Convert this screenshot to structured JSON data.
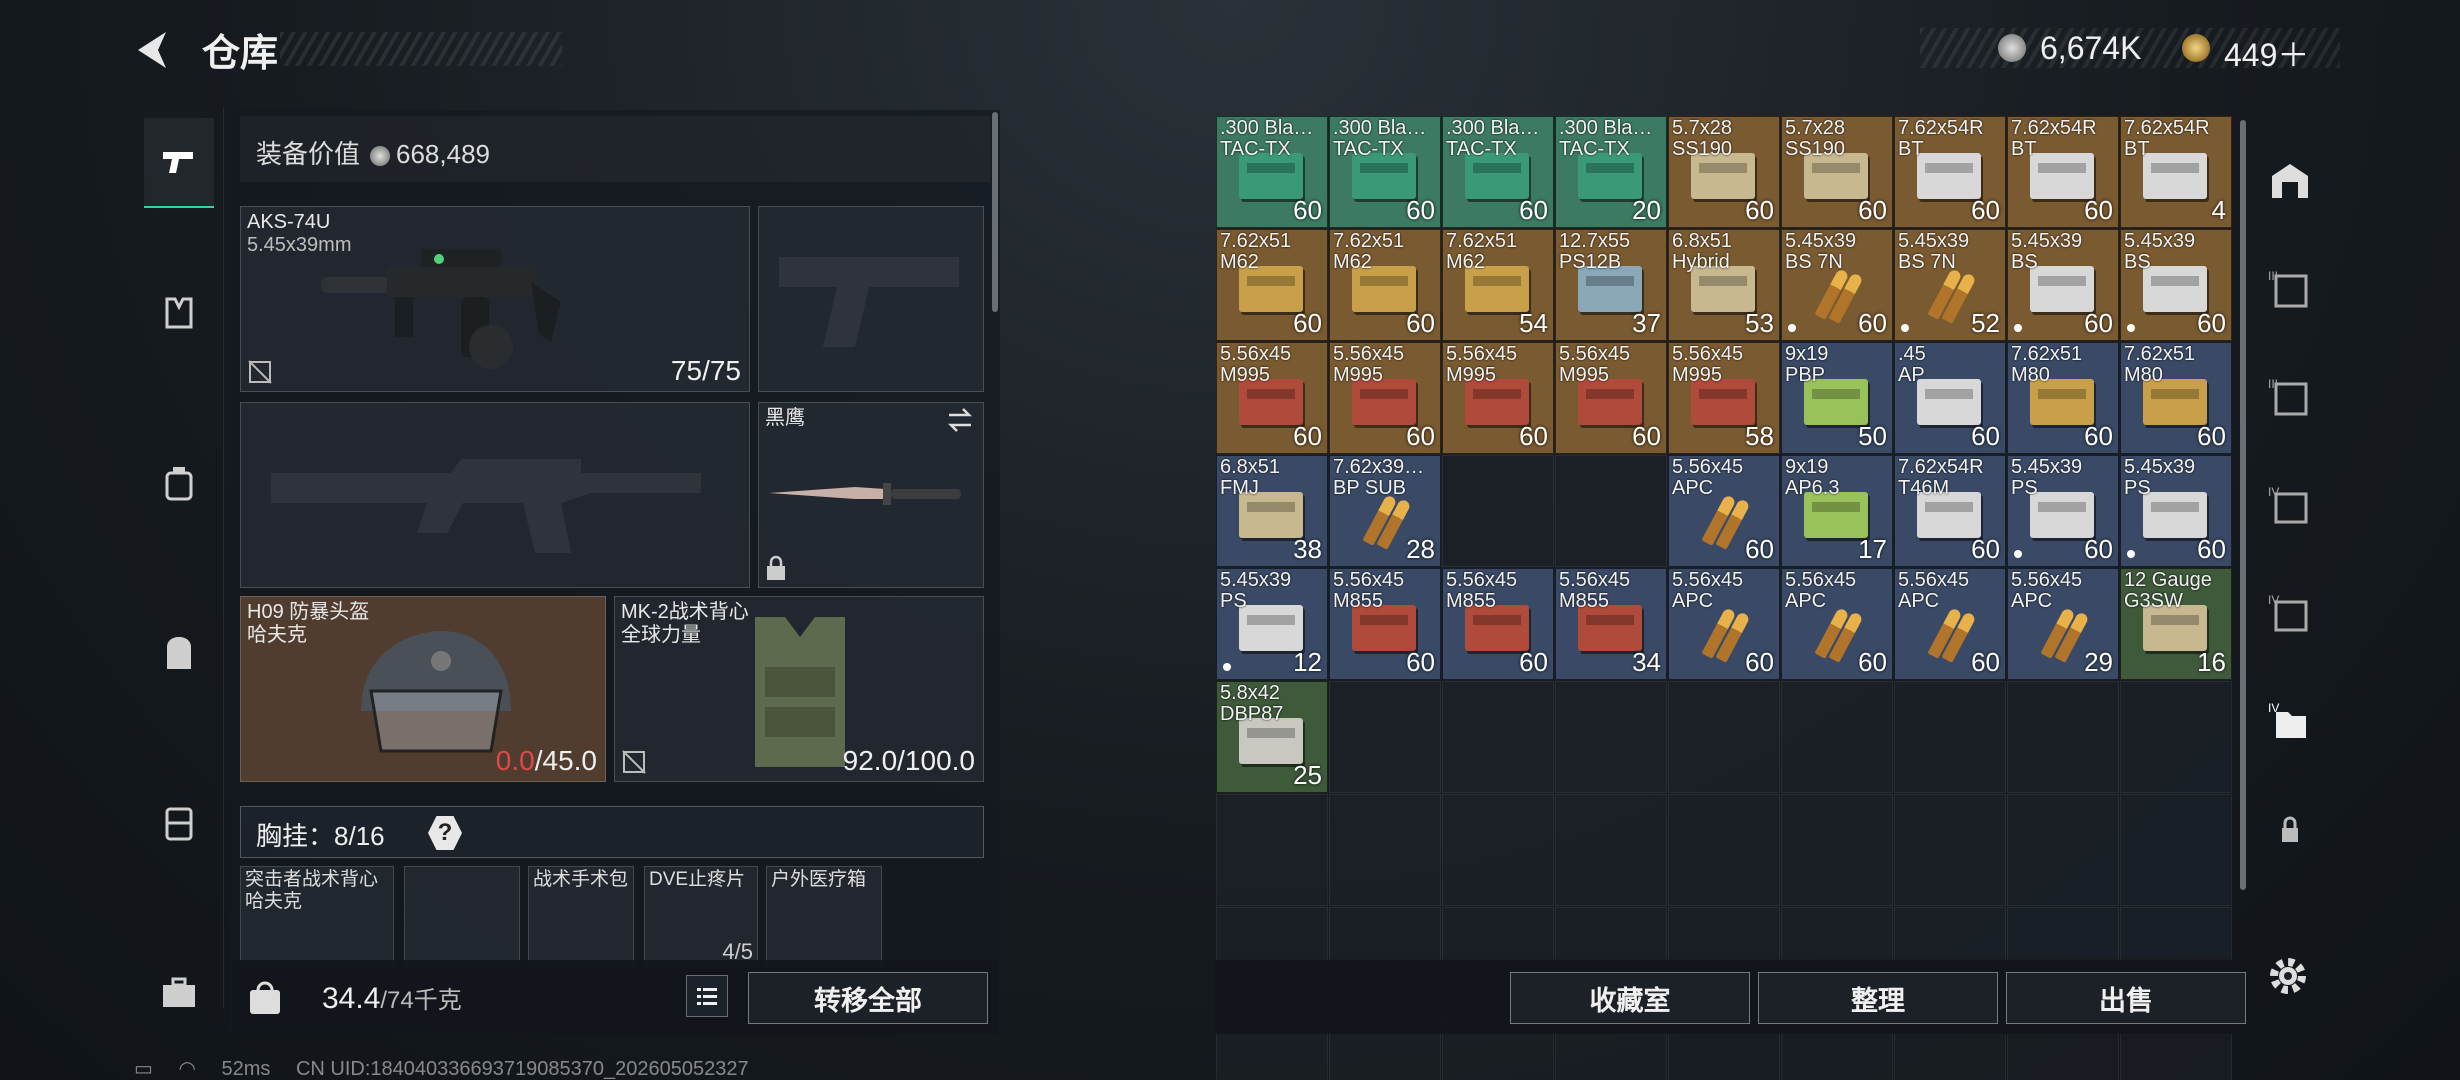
{
  "header": {
    "title": "仓库",
    "money": "6,674K",
    "gold": "449＋"
  },
  "left_nav": {
    "items": [
      "pistol-icon",
      "vest-icon",
      "backpack-armor-icon",
      "backpack-icon",
      "case-icon",
      "toolbox-icon"
    ]
  },
  "equipment": {
    "value_label": "装备价值",
    "value": "668,489",
    "primary": {
      "name": "AKS-74U",
      "caliber": "5.45x39mm",
      "ammo": "75/75"
    },
    "melee": {
      "name": "黑鹰"
    },
    "helmet": {
      "name": "H09 防暴头盔",
      "brand": "哈夫克",
      "durability_current": "0.0",
      "durability_max": "/45.0"
    },
    "armor": {
      "name": "MK-2战术背心",
      "brand": "全球力量",
      "durability": "92.0/100.0"
    },
    "rig": {
      "label": "胸挂：",
      "count": "8/16",
      "help": "?",
      "slots": [
        {
          "name": "突击者战术背心\n哈夫克"
        },
        {
          "name": ""
        },
        {
          "name": "战术手术包"
        },
        {
          "name": "DVE止疼片",
          "count": "4/5"
        },
        {
          "name": "户外医疗箱"
        }
      ]
    },
    "weight": "34.4",
    "weight_max": "/74千克",
    "transfer_all": "转移全部"
  },
  "stash": {
    "items": [
      {
        "name": ".300 Bla…\nTAC-TX",
        "count": "60",
        "color": "#3d7a62",
        "box": "#3a9a78"
      },
      {
        "name": ".300 Bla…\nTAC-TX",
        "count": "60",
        "color": "#3d7a62",
        "box": "#3a9a78"
      },
      {
        "name": ".300 Bla…\nTAC-TX",
        "count": "60",
        "color": "#3d7a62",
        "box": "#3a9a78"
      },
      {
        "name": ".300 Bla…\nTAC-TX",
        "count": "20",
        "color": "#3d7a62",
        "box": "#3a9a78"
      },
      {
        "name": "5.7x28\nSS190",
        "count": "60",
        "color": "#7a5a30",
        "box": "#c8b890"
      },
      {
        "name": "5.7x28\nSS190",
        "count": "60",
        "color": "#7a5a30",
        "box": "#c8b890"
      },
      {
        "name": "7.62x54R\nBT",
        "count": "60",
        "color": "#7a5a30",
        "box": "#d8d8d8"
      },
      {
        "name": "7.62x54R\nBT",
        "count": "60",
        "color": "#7a5a30",
        "box": "#d8d8d8"
      },
      {
        "name": "7.62x54R\nBT",
        "count": "4",
        "color": "#7a5a30",
        "box": "#d8d8d8"
      },
      {
        "name": "7.62x51\nM62",
        "count": "60",
        "color": "#7a5a30",
        "box": "#c9a04a"
      },
      {
        "name": "7.62x51\nM62",
        "count": "60",
        "color": "#7a5a30",
        "box": "#c9a04a"
      },
      {
        "name": "7.62x51\nM62",
        "count": "54",
        "color": "#7a5a30",
        "box": "#c9a04a"
      },
      {
        "name": "12.7x55\nPS12B",
        "count": "37",
        "color": "#7a5a30",
        "box": "#8aa8b8"
      },
      {
        "name": "6.8x51\nHybrid",
        "count": "53",
        "color": "#7a5a30",
        "box": "#c8b890"
      },
      {
        "name": "5.45x39\nBS 7N",
        "count": "60",
        "dot": true,
        "color": "#7a5a30",
        "cart": true
      },
      {
        "name": "5.45x39\nBS 7N",
        "count": "52",
        "dot": true,
        "color": "#7a5a30",
        "cart": true
      },
      {
        "name": "5.45x39\nBS",
        "count": "60",
        "dot": true,
        "color": "#7a5a30",
        "box": "#d8d8d8"
      },
      {
        "name": "5.45x39\nBS",
        "count": "60",
        "dot": true,
        "color": "#7a5a30",
        "box": "#d8d8d8"
      },
      {
        "name": "5.56x45\nM995",
        "count": "60",
        "color": "#7a5a30",
        "box": "#b04a3a"
      },
      {
        "name": "5.56x45\nM995",
        "count": "60",
        "color": "#7a5a30",
        "box": "#b04a3a"
      },
      {
        "name": "5.56x45\nM995",
        "count": "60",
        "color": "#7a5a30",
        "box": "#b04a3a"
      },
      {
        "name": "5.56x45\nM995",
        "count": "60",
        "color": "#7a5a30",
        "box": "#b04a3a"
      },
      {
        "name": "5.56x45\nM995",
        "count": "58",
        "color": "#7a5a30",
        "box": "#b04a3a"
      },
      {
        "name": "9x19\nPBP",
        "count": "50",
        "color": "#3a4a66",
        "box": "#9ac25a"
      },
      {
        "name": ".45\nAP",
        "count": "60",
        "color": "#3a4a66",
        "box": "#d8d8d8"
      },
      {
        "name": "7.62x51\nM80",
        "count": "60",
        "color": "#3a4a66",
        "box": "#c9a04a"
      },
      {
        "name": "7.62x51\nM80",
        "count": "60",
        "color": "#3a4a66",
        "box": "#c9a04a"
      },
      {
        "name": "6.8x51\nFMJ",
        "count": "38",
        "color": "#3a4a66",
        "box": "#c8b890"
      },
      {
        "name": "7.62x39…\nBP SUB",
        "count": "28",
        "color": "#3a4a66",
        "cart": true
      },
      null,
      null,
      {
        "name": "5.56x45\nAPC",
        "count": "60",
        "color": "#3a4a66",
        "cart": true
      },
      {
        "name": "9x19\nAP6.3",
        "count": "17",
        "color": "#3a4a66",
        "box": "#9ac25a"
      },
      {
        "name": "7.62x54R\nT46M",
        "count": "60",
        "color": "#3a4a66",
        "box": "#d8d8d8"
      },
      {
        "name": "5.45x39\nPS",
        "count": "60",
        "dot": true,
        "color": "#3a4a66",
        "box": "#d8d8d8"
      },
      {
        "name": "5.45x39\nPS",
        "count": "60",
        "dot": true,
        "color": "#3a4a66",
        "box": "#d8d8d8"
      },
      {
        "name": "5.45x39\nPS",
        "count": "12",
        "dot": true,
        "color": "#3a4a66",
        "box": "#d8d8d8"
      },
      {
        "name": "5.56x45\nM855",
        "count": "60",
        "color": "#3a4a66",
        "box": "#b04a3a"
      },
      {
        "name": "5.56x45\nM855",
        "count": "60",
        "color": "#3a4a66",
        "box": "#b04a3a"
      },
      {
        "name": "5.56x45\nM855",
        "count": "34",
        "color": "#3a4a66",
        "box": "#b04a3a"
      },
      {
        "name": "5.56x45\nAPC",
        "count": "60",
        "color": "#3a4a66",
        "cart": true
      },
      {
        "name": "5.56x45\nAPC",
        "count": "60",
        "color": "#3a4a66",
        "cart": true
      },
      {
        "name": "5.56x45\nAPC",
        "count": "60",
        "color": "#3a4a66",
        "cart": true
      },
      {
        "name": "5.56x45\nAPC",
        "count": "29",
        "color": "#3a4a66",
        "cart": true
      },
      {
        "name": "12 Gauge\nG3SW",
        "count": "16",
        "color": "#3e5a3a",
        "box": "#c8b890"
      },
      {
        "name": "5.8x42\nDBP87",
        "count": "25",
        "color": "#3e5a3a",
        "box": "#c8c8c0"
      }
    ],
    "total_cells": 81
  },
  "actions": {
    "collect": "收藏室",
    "sort": "整理",
    "sell": "出售"
  },
  "right_nav": {
    "items": [
      "stash-home-icon",
      "storage-3-icon",
      "storage-3b-icon",
      "storage-4-icon",
      "storage-4b-icon",
      "storage-4c-icon",
      "lock-icon"
    ]
  },
  "footer": {
    "ping": "52ms",
    "uid": "CN UID:184040336693719085370_202605052327"
  }
}
